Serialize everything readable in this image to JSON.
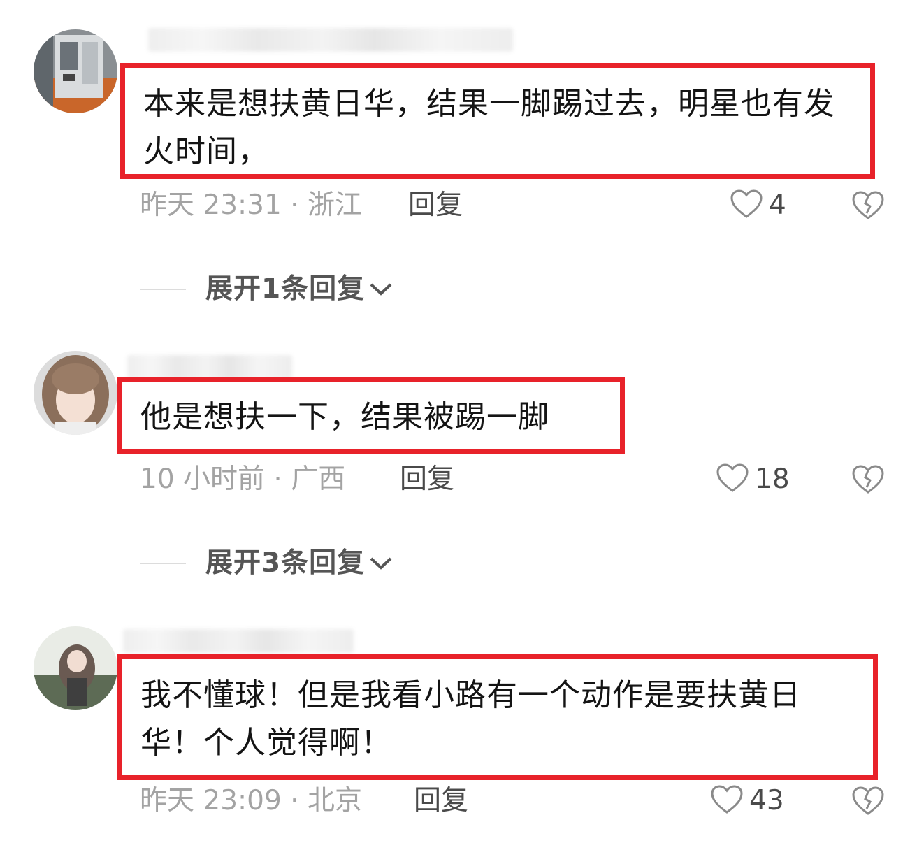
{
  "comments": [
    {
      "text": "本来是想扶黄日华，结果一脚踢过去，明星也有发火时间，",
      "time_location": "昨天 23:31 · 浙江",
      "reply_label": "回复",
      "likes": "4",
      "expand_label": "展开1条回复"
    },
    {
      "text": "他是想扶一下，结果被踢一脚",
      "time_location": "10 小时前 · 广西",
      "reply_label": "回复",
      "likes": "18",
      "expand_label": "展开3条回复"
    },
    {
      "text": "我不懂球！但是我看小路有一个动作是要扶黄日华！个人觉得啊！",
      "time_location": "昨天 23:09 · 北京",
      "reply_label": "回复",
      "likes": "43"
    }
  ],
  "colors": {
    "highlight_border": "#e8222a",
    "meta_text": "#a3a3a3"
  },
  "icons": {
    "like": "heart-outline-icon",
    "dislike": "broken-heart-icon",
    "expand": "chevron-down-icon"
  }
}
